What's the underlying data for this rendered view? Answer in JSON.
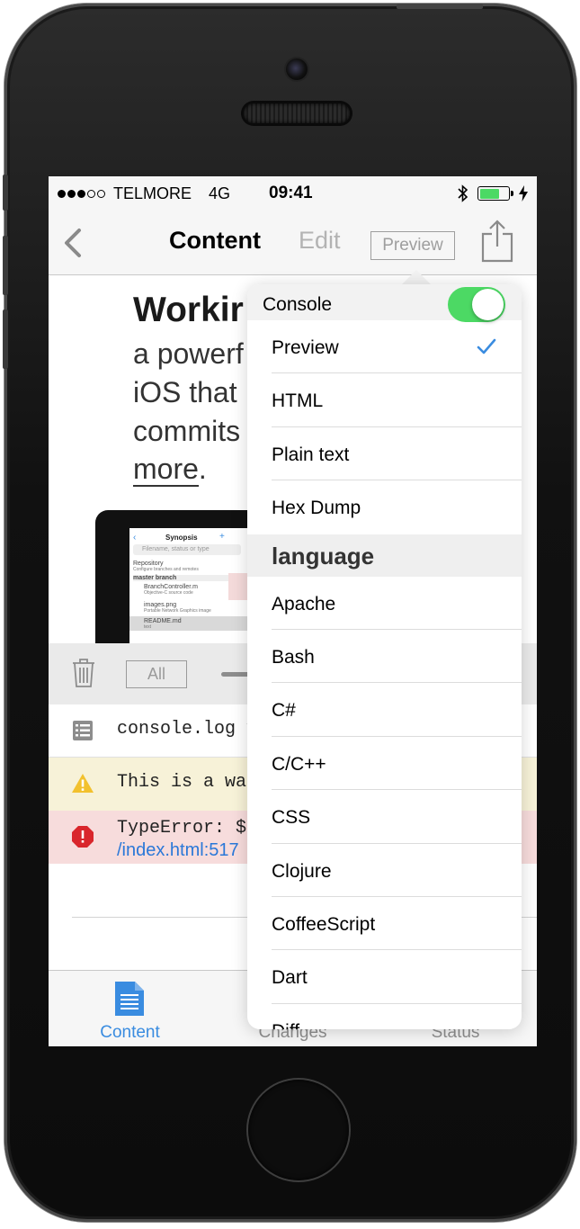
{
  "status_bar": {
    "carrier": "TELMORE",
    "network": "4G",
    "time": "09:41",
    "signal_dots_filled": 3,
    "signal_dots_total": 5,
    "battery_color": "#4cd964"
  },
  "nav": {
    "title": "Content",
    "edit_label": "Edit",
    "preview_label": "Preview"
  },
  "document": {
    "heading": "Workir",
    "lines": [
      "a powerf",
      "iOS that",
      "commits"
    ],
    "link_text": "more",
    "link_suffix": "."
  },
  "ipad_preview": {
    "title": "Synopsis",
    "search_placeholder": "Filename, status or type",
    "repository": "Repository",
    "repository_sub": "Configure branches and remotes",
    "branch": "master branch",
    "files": [
      {
        "name": "BranchController.m",
        "sub": "Objective-C source code"
      },
      {
        "name": "images.png",
        "sub": "Portable Network Graphics image"
      },
      {
        "name": "README.md",
        "sub": "text"
      }
    ]
  },
  "console": {
    "all_label": "All",
    "rows": [
      {
        "type": "log",
        "text": "console.log v",
        "icon": "list-icon"
      },
      {
        "type": "warning",
        "text": "This is a wa",
        "icon": "warning-icon"
      },
      {
        "type": "error",
        "text": "TypeError: $",
        "link": "/index.html:517",
        "icon": "error-icon"
      }
    ]
  },
  "tabs": [
    {
      "label": "Content",
      "active": true
    },
    {
      "label": "Changes",
      "active": false
    },
    {
      "label": "Status",
      "active": false
    }
  ],
  "popover": {
    "console_label": "Console",
    "console_enabled": true,
    "options": [
      {
        "label": "Preview",
        "checked": true
      },
      {
        "label": "HTML",
        "checked": false
      },
      {
        "label": "Plain text",
        "checked": false
      },
      {
        "label": "Hex Dump",
        "checked": false
      }
    ],
    "section_title": "language",
    "languages": [
      "Apache",
      "Bash",
      "C#",
      "C/C++",
      "CSS",
      "Clojure",
      "CoffeeScript",
      "Dart",
      "Diff"
    ]
  },
  "colors": {
    "accent": "#3a8ce0",
    "toggle_on": "#4cd964",
    "warning_bg": "#f7f2d8",
    "error_bg": "#f7dcdc",
    "warning_icon": "#f2c12e",
    "error_icon": "#d9262c"
  }
}
